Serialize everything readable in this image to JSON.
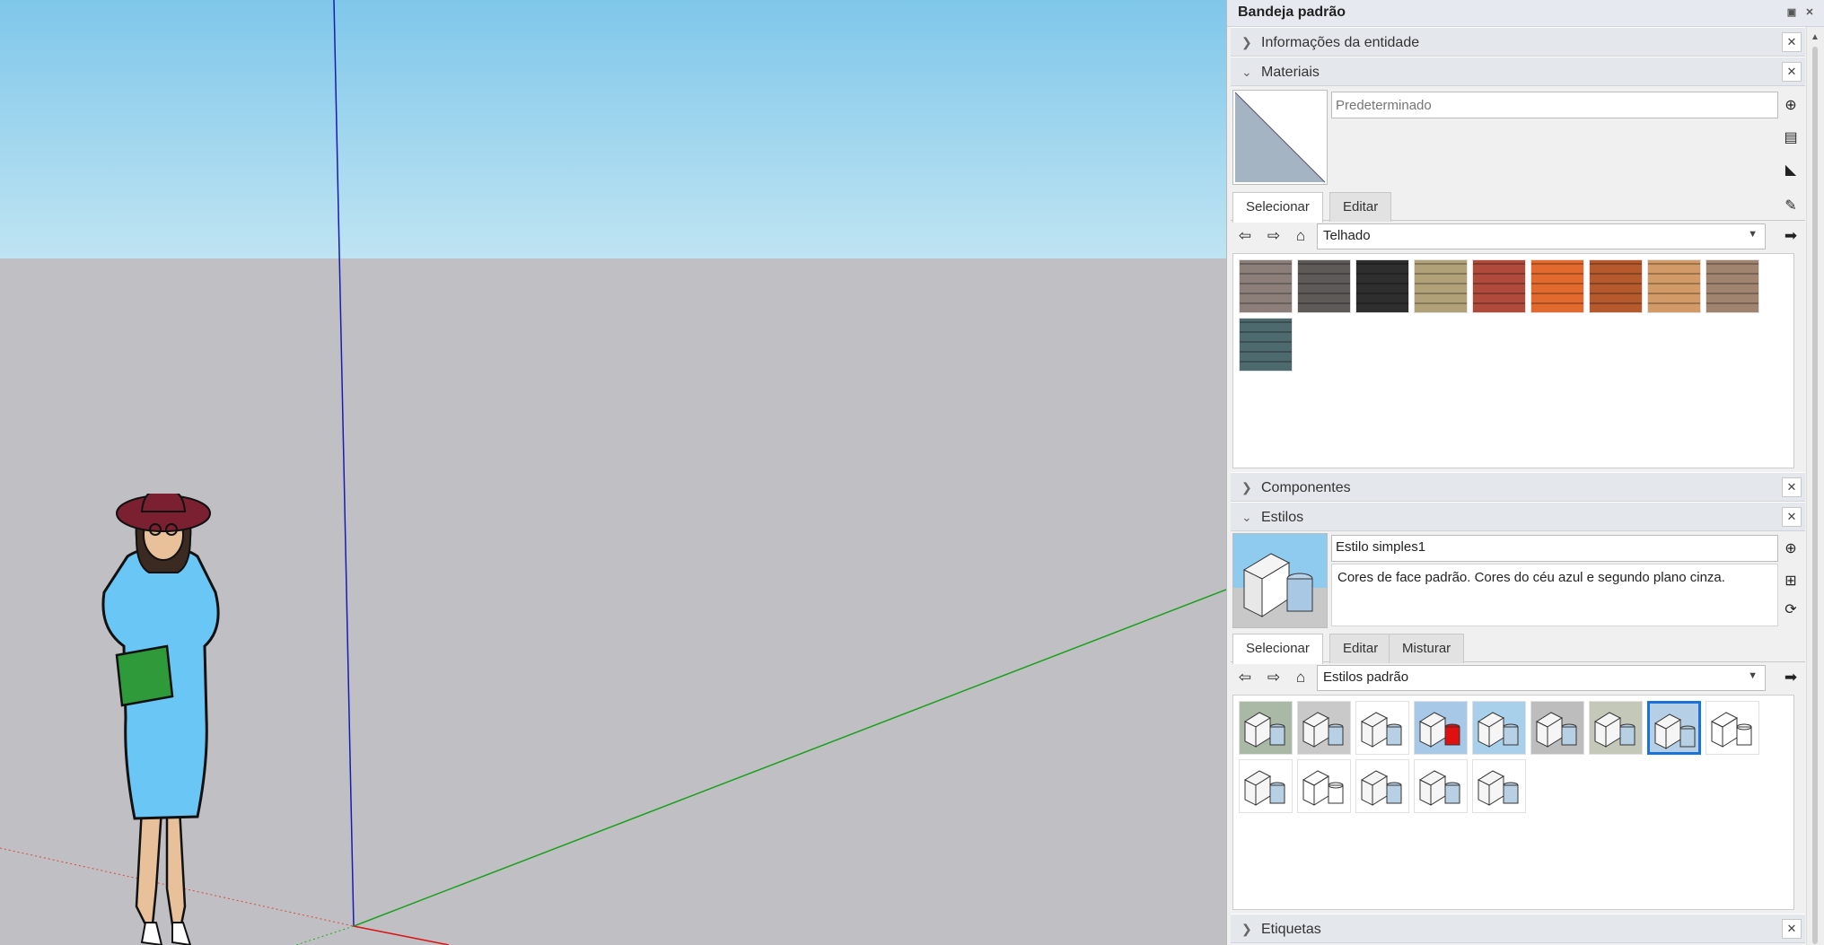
{
  "tray": {
    "title": "Bandeja padrão",
    "pin_icon": "pin-icon",
    "close_icon": "close-icon"
  },
  "panels": {
    "entity_info": {
      "title": "Informações da entidade",
      "expanded": false
    },
    "materials": {
      "title": "Materiais",
      "expanded": true,
      "name_placeholder": "Predeterminado",
      "tabs": [
        {
          "label": "Selecionar",
          "active": true
        },
        {
          "label": "Editar",
          "active": false
        }
      ],
      "library": "Telhado",
      "swatches": [
        {
          "name": "roof-tile-1",
          "color": "#8c7f7a"
        },
        {
          "name": "roof-tile-2",
          "color": "#5e5a58"
        },
        {
          "name": "roof-tile-3",
          "color": "#2e2e2e"
        },
        {
          "name": "roof-tile-4",
          "color": "#b1a178"
        },
        {
          "name": "roof-tile-5",
          "color": "#b04a3a"
        },
        {
          "name": "roof-tile-6",
          "color": "#e36a2e"
        },
        {
          "name": "roof-tile-7",
          "color": "#b65a2e"
        },
        {
          "name": "roof-tile-8",
          "color": "#d29a66"
        },
        {
          "name": "roof-tile-9",
          "color": "#a08470"
        },
        {
          "name": "roof-tile-10",
          "color": "#4d6a6e"
        }
      ]
    },
    "components": {
      "title": "Componentes",
      "expanded": false
    },
    "styles": {
      "title": "Estilos",
      "expanded": true,
      "style_name": "Estilo simples1",
      "description": "Cores de face padrão. Cores do céu azul e segundo plano cinza.",
      "tabs": [
        {
          "label": "Selecionar",
          "active": true
        },
        {
          "label": "Editar",
          "active": false
        },
        {
          "label": "Misturar",
          "active": false
        }
      ],
      "library": "Estilos padrão",
      "thumbs": [
        {
          "bg": "#a9b9a6"
        },
        {
          "bg": "#c9c9c9"
        },
        {
          "bg": "#ffffff"
        },
        {
          "bg": "#a8c8e8",
          "red": true
        },
        {
          "bg": "#a9d0ea"
        },
        {
          "bg": "#bdbdbd"
        },
        {
          "bg": "#c3c8b8"
        },
        {
          "bg": "#b5cfe6",
          "selected": true
        },
        {
          "bg": "#ffffff",
          "wire": true
        },
        {
          "bg": "#ffffff"
        },
        {
          "bg": "#ffffff",
          "wire": true
        },
        {
          "bg": "#ffffff"
        },
        {
          "bg": "#ffffff"
        },
        {
          "bg": "#ffffff"
        }
      ]
    },
    "tags": {
      "title": "Etiquetas",
      "expanded": false
    }
  }
}
